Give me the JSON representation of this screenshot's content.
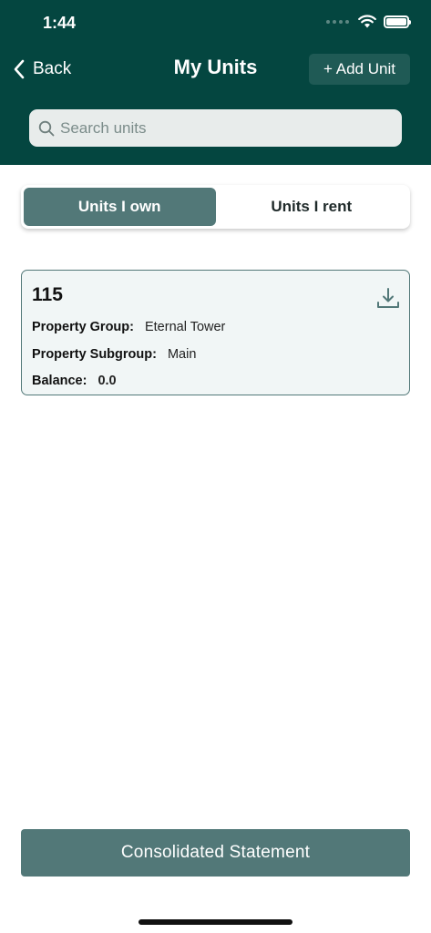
{
  "status_bar": {
    "time": "1:44"
  },
  "nav": {
    "back_label": "Back",
    "title": "My Units",
    "add_label": "+ Add Unit"
  },
  "search": {
    "placeholder": "Search units",
    "value": ""
  },
  "tabs": [
    {
      "label": "Units I own",
      "active": true
    },
    {
      "label": "Units I rent",
      "active": false
    }
  ],
  "units": [
    {
      "number": "115",
      "property_group_label": "Property Group:",
      "property_group": "Eternal Tower",
      "property_subgroup_label": "Property Subgroup:",
      "property_subgroup": "Main",
      "balance_label": "Balance:",
      "balance": "0.0"
    }
  ],
  "footer": {
    "cta_label": "Consolidated Statement"
  },
  "colors": {
    "header_bg": "#044640",
    "accent": "#527878",
    "add_button_bg": "#1f5a55",
    "card_bg": "#f1f6f6"
  },
  "icons": {
    "back": "chevron-left-icon",
    "search": "search-icon",
    "download": "download-icon",
    "wifi": "wifi-icon",
    "battery": "battery-icon"
  }
}
